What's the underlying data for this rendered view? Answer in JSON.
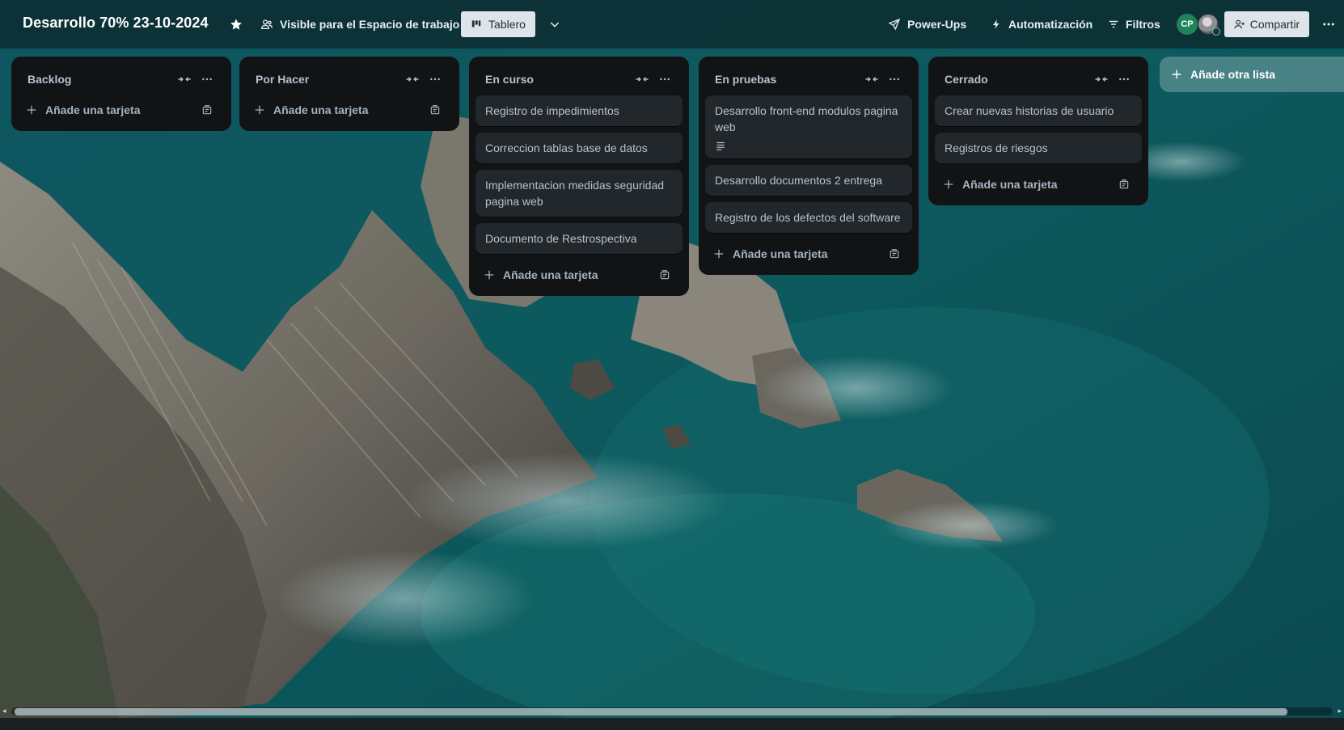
{
  "board": {
    "title": "Desarrollo 70% 23-10-2024",
    "visibility": "Visible para el Espacio de trabajo",
    "view": "Tablero",
    "powerups": "Power-Ups",
    "automation": "Automatización",
    "filters": "Filtros",
    "share": "Compartir",
    "avatar_initials": "CP"
  },
  "lists": [
    {
      "title": "Backlog",
      "cards": [],
      "add_card": "Añade una tarjeta"
    },
    {
      "title": "Por Hacer",
      "cards": [],
      "add_card": "Añade una tarjeta"
    },
    {
      "title": "En curso",
      "cards": [
        "Registro de impedimientos",
        "Correccion tablas base de datos",
        "Implementacion medidas seguridad pagina web",
        "Documento de Restrospectiva"
      ],
      "add_card": "Añade una tarjeta"
    },
    {
      "title": "En pruebas",
      "cards": [
        "Desarrollo front-end modulos pagina web",
        "Desarrollo documentos 2 entrega",
        "Registro de los defectos del software"
      ],
      "add_card": "Añade una tarjeta"
    },
    {
      "title": "Cerrado",
      "cards": [
        "Crear nuevas historias de usuario",
        "Registros de riesgos"
      ],
      "add_card": "Añade una tarjeta"
    }
  ],
  "add_list": "Añade otra lista",
  "icons": {
    "star": "star-icon",
    "visibility": "people-icon",
    "view": "board-icon",
    "chevron": "chevron-down-icon",
    "powerups": "rocket-icon",
    "automation": "lightning-icon",
    "filters": "filter-icon",
    "share": "add-person-icon",
    "more": "more-icon",
    "collapse": "collapse-icon",
    "plus": "plus-icon",
    "template": "template-icon",
    "description": "description-icon"
  },
  "colors": {
    "list_bg": "#111315",
    "card_bg": "#22272b",
    "avatar_bg": "#1f845a",
    "view_button_bg": "#dfe4e8"
  }
}
